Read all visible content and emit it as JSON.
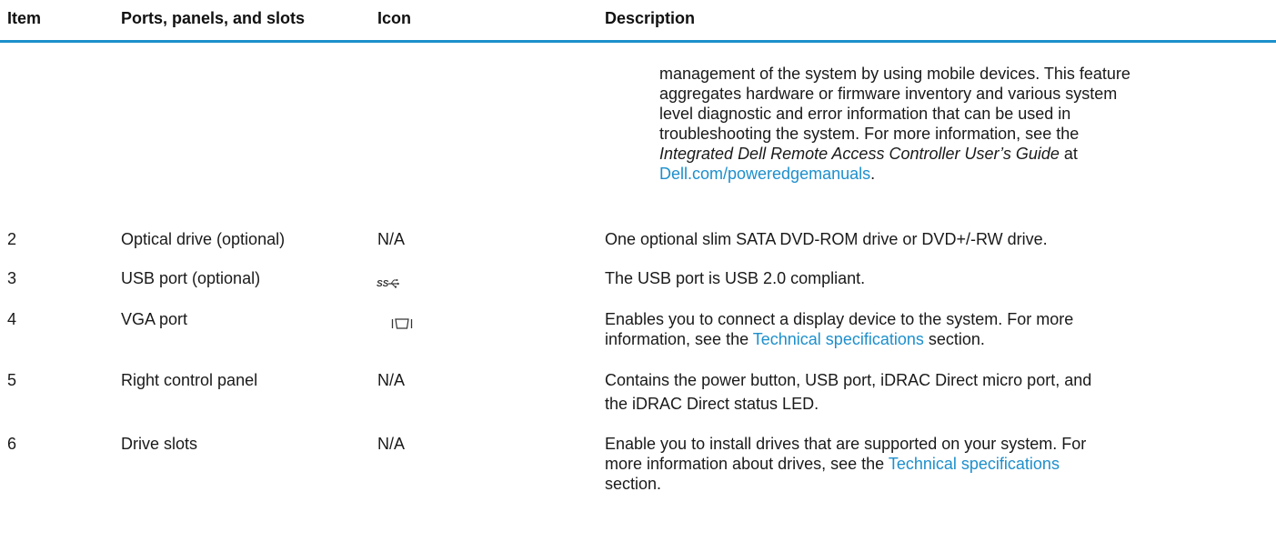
{
  "table": {
    "headers": {
      "item": "Item",
      "ports": "Ports, panels, and slots",
      "icon": "Icon",
      "description": "Description"
    },
    "continuation": {
      "line1": "management of the system by using mobile devices. This feature",
      "line2": "aggregates hardware or firmware inventory and various system",
      "line3": "level diagnostic and error information that can be used in",
      "line4": "troubleshooting the system. For more information, see the",
      "guide_title": "Integrated Dell Remote Access Controller User’s Guide",
      "guide_suffix": " at",
      "link": "Dell.com/poweredgemanuals",
      "period": "."
    },
    "rows": [
      {
        "item": "2",
        "ports": "Optical drive (optional)",
        "icon": "N/A",
        "description": "One optional slim SATA DVD-ROM drive or DVD+/-RW drive."
      },
      {
        "item": "3",
        "ports": "USB port (optional)",
        "icon_name": "usb-superspeed-icon",
        "description": "The USB port is USB 2.0 compliant."
      },
      {
        "item": "4",
        "ports": "VGA port",
        "icon_name": "vga-port-icon",
        "desc_part1": "Enables you to connect a display device to the system. For more",
        "desc_part2": "information, see the ",
        "desc_link": "Technical specifications",
        "desc_part3": " section."
      },
      {
        "item": "5",
        "ports": "Right control panel",
        "icon": "N/A",
        "desc_line1": "Contains the power button, USB port, iDRAC Direct micro port, and",
        "desc_line2": "the iDRAC Direct status LED."
      },
      {
        "item": "6",
        "ports": "Drive slots",
        "icon": "N/A",
        "desc_line1": "Enable you to install drives that are supported on your system. For",
        "desc_part2": "more information about drives, see the ",
        "desc_link": "Technical specifications",
        "desc_line3": "section."
      }
    ]
  },
  "colors": {
    "accent": "#1d8fcc",
    "text": "#1a1a1a"
  }
}
